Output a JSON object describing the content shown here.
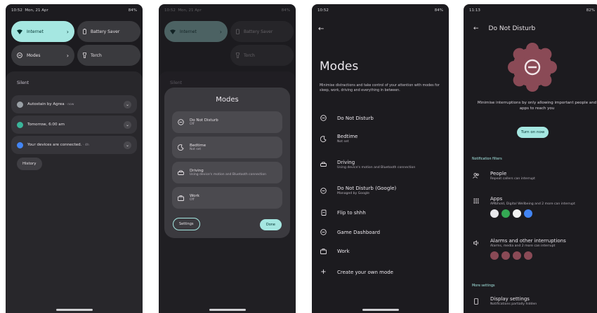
{
  "colors": {
    "bg": "#1c1b1f",
    "accent": "#a5e7e1",
    "tile_off": "#3a3a3e",
    "flower": "#8a4a56"
  },
  "phone1": {
    "status_time": "10:52",
    "status_date": "Mon, 21 Apr",
    "battery": "84%",
    "tiles": [
      {
        "label": "Internet",
        "icon": "wifi-icon"
      },
      {
        "label": "Battery Saver",
        "icon": "battery-icon"
      },
      {
        "label": "Modes",
        "icon": "modes-icon"
      },
      {
        "label": "Torch",
        "icon": "torch-icon"
      }
    ],
    "silent_label": "Silent",
    "notifications": [
      {
        "title": "Autostain by Agrea",
        "sub": "· now",
        "icon": "app-icon"
      },
      {
        "title": "Tomorrow, 6:00 am",
        "sub": "",
        "icon": "alarm-icon"
      },
      {
        "title": "Your devices are connected.",
        "sub": "· 4h",
        "icon": "shield-icon"
      }
    ],
    "history_label": "History"
  },
  "phone2": {
    "status_time": "10:52",
    "status_date": "Mon, 21 Apr",
    "battery": "84%",
    "tiles": [
      {
        "label": "Internet",
        "icon": "wifi-icon"
      },
      {
        "label": "Battery Saver",
        "icon": "battery-icon"
      },
      {
        "label": "Torch",
        "icon": "torch-icon"
      }
    ],
    "silent_label": "Silent",
    "dialog_title": "Modes",
    "modes": [
      {
        "name": "Do Not Disturb",
        "sub": "Off"
      },
      {
        "name": "Bedtime",
        "sub": "Not set"
      },
      {
        "name": "Driving",
        "sub": "Using device's motion and Bluetooth connection"
      },
      {
        "name": "Work",
        "sub": "Off"
      }
    ],
    "settings_label": "Settings",
    "done_label": "Done"
  },
  "phone3": {
    "status_time": "10:52",
    "battery": "84%",
    "title": "Modes",
    "description": "Minimise distractions and take control of your attention with modes for sleep, work, driving and everything in between.",
    "items": [
      {
        "name": "Do Not Disturb",
        "sub": "",
        "icon": "dnd-icon"
      },
      {
        "name": "Bedtime",
        "sub": "Not set",
        "icon": "moon-icon"
      },
      {
        "name": "Driving",
        "sub": "Using device's motion and Bluetooth connection",
        "icon": "car-icon"
      },
      {
        "name": "Do Not Disturb (Google)",
        "sub": "Managed by Google",
        "icon": "dnd-icon"
      },
      {
        "name": "Flip to shhh",
        "sub": "",
        "icon": "flip-icon"
      },
      {
        "name": "Game Dashboard",
        "sub": "",
        "icon": "dnd-icon"
      },
      {
        "name": "Work",
        "sub": "",
        "icon": "briefcase-icon"
      },
      {
        "name": "Create your own mode",
        "sub": "",
        "icon": "plus-icon"
      }
    ]
  },
  "phone4": {
    "status_time": "11:13",
    "battery": "82%",
    "title": "Do Not Disturb",
    "description": "Minimise interruptions by only allowing important people and apps to reach you",
    "turn_on_label": "Turn on now",
    "filters_header": "Notification filters",
    "filters": [
      {
        "name": "People",
        "sub": "Repeat callers can interrupt",
        "icon": "people-icon"
      },
      {
        "name": "Apps",
        "sub": "AMbhold, Digital Wellbeing and 2 more can interrupt",
        "icon": "apps-icon"
      },
      {
        "name": "Alarms and other interruptions",
        "sub": "Alarms, media and 2 more can interrupt",
        "icon": "volume-icon"
      }
    ],
    "more_header": "More settings",
    "display": {
      "name": "Display settings",
      "sub": "Notifications partially hidden",
      "icon": "phone-icon"
    }
  }
}
